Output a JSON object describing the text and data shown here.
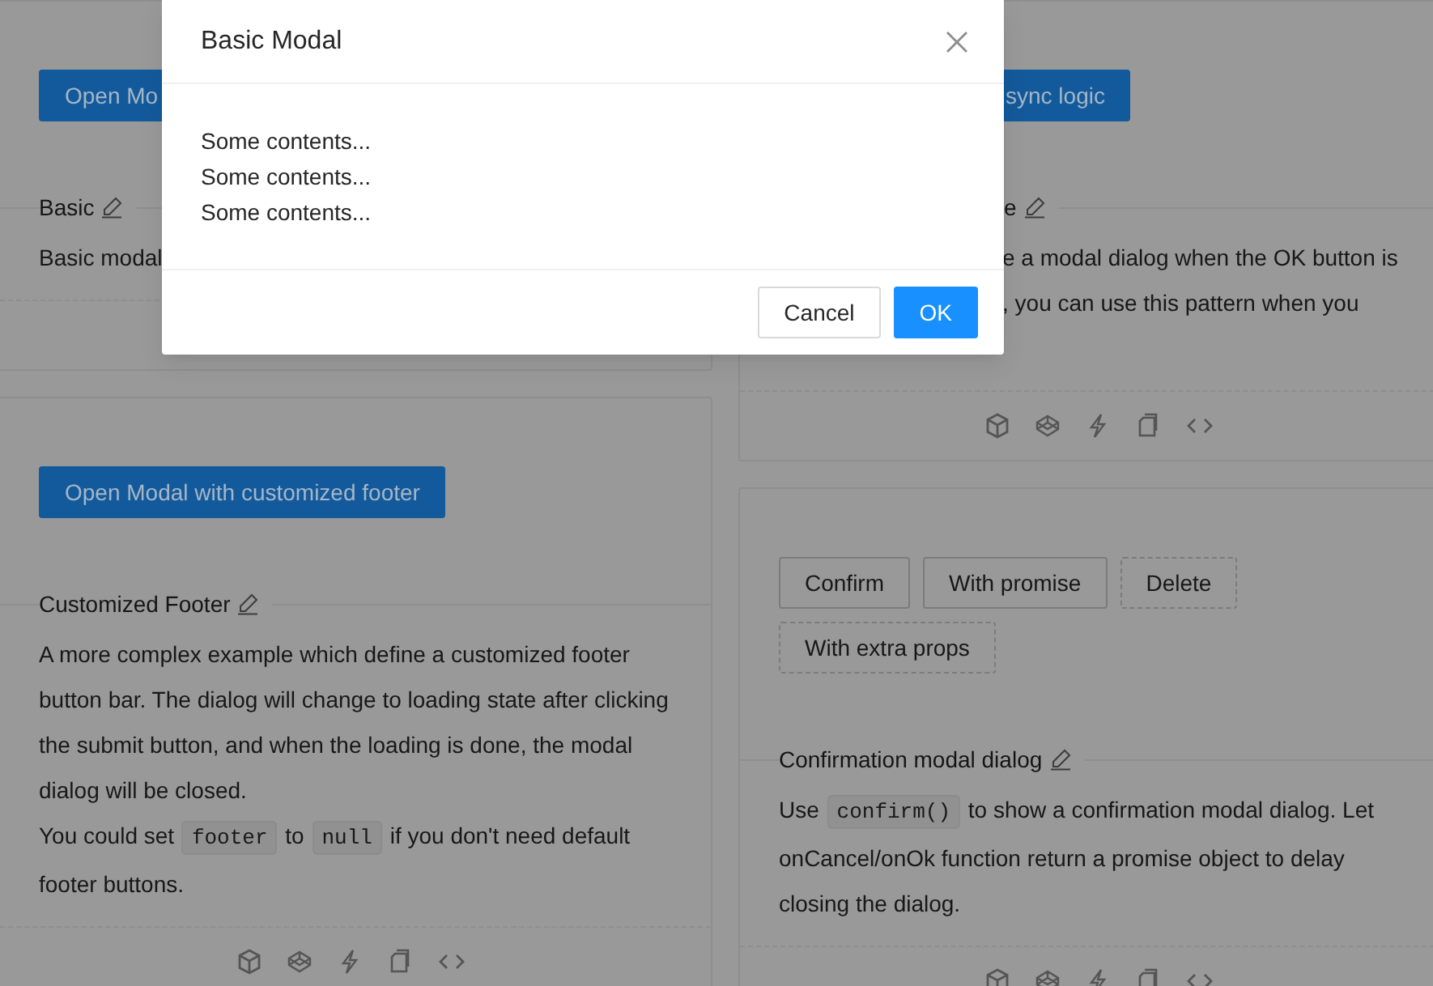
{
  "left_column": {
    "cards": [
      {
        "kind": "clipped_right",
        "buttons": [
          {
            "label": "Open Mo",
            "kind": "primary"
          }
        ],
        "title": "Basic",
        "description": [
          [
            {
              "kind": "text",
              "text": "Basic modal"
            }
          ]
        ]
      },
      {
        "kind": "full",
        "buttons": [
          {
            "label": "Open Modal with customized footer",
            "kind": "primary"
          }
        ],
        "title": "Customized Footer",
        "description": [
          [
            {
              "kind": "text",
              "text": "A more complex example which define a customized footer button bar. The dialog will change to loading state after clicking the submit button, and when the loading is done, the modal dialog will be closed."
            }
          ],
          [
            {
              "kind": "text",
              "text": "You could set "
            },
            {
              "kind": "code",
              "text": "footer"
            },
            {
              "kind": "text",
              "text": " to "
            },
            {
              "kind": "code",
              "text": "null"
            },
            {
              "kind": "text",
              "text": " if you don't need default footer buttons."
            }
          ]
        ]
      }
    ]
  },
  "right_column": {
    "cards": [
      {
        "kind": "clipped_left",
        "buttons": [
          {
            "label": "sync logic",
            "kind": "primary"
          }
        ],
        "title": "e",
        "description": [
          [
            {
              "kind": "text",
              "text": "e a modal dialog when the OK button is"
            }
          ],
          [
            {
              "kind": "text",
              "text": ", you can use this pattern when you"
            }
          ]
        ]
      },
      {
        "kind": "full",
        "buttons": [
          {
            "label": "Confirm",
            "kind": "default"
          },
          {
            "label": "With promise",
            "kind": "default"
          },
          {
            "label": "Delete",
            "kind": "dashed"
          },
          {
            "label": "With extra props",
            "kind": "dashed"
          }
        ],
        "title": "Confirmation modal dialog",
        "description": [
          [
            {
              "kind": "text",
              "text": "Use "
            },
            {
              "kind": "code",
              "text": "confirm()"
            },
            {
              "kind": "text",
              "text": " to show a confirmation modal dialog. Let onCancel/onOk function return a promise object to delay closing the dialog."
            }
          ]
        ]
      }
    ]
  },
  "modal": {
    "title": "Basic Modal",
    "body": [
      "Some contents...",
      "Some contents...",
      "Some contents..."
    ],
    "buttons": [
      {
        "label": "Cancel",
        "kind": "default"
      },
      {
        "label": "OK",
        "kind": "primary"
      }
    ]
  }
}
